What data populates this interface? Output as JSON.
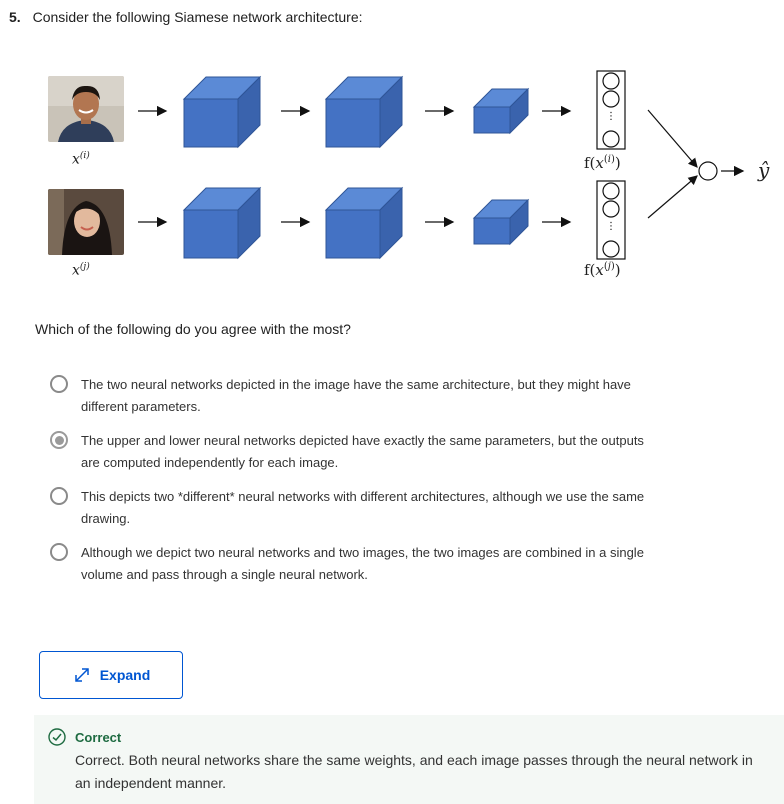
{
  "question": {
    "number": "5.",
    "text": "Consider the following Siamese network architecture:",
    "prompt": "Which of the following do you agree with the most?"
  },
  "diagram": {
    "input_top_label": "x(i)",
    "input_bottom_label": "x(j)",
    "output_top_label": "f(x(i))",
    "output_bottom_label": "f(x(j))",
    "final_output_label": "ŷ",
    "cube_color": "#4472c4",
    "photo_top_desc_icon": "male-face-photo",
    "photo_bottom_desc_icon": "female-face-photo"
  },
  "options": [
    {
      "text": "The two neural networks depicted in the image have the same architecture, but they might have different parameters.",
      "selected": false
    },
    {
      "text": "The upper and lower neural networks depicted have exactly the same parameters, but the outputs are computed independently for each image.",
      "selected": true
    },
    {
      "text": "This depicts two *different* neural networks with different architectures, although we use the same drawing.",
      "selected": false
    },
    {
      "text": "Although we depict two neural networks and two images, the two images are combined in a single volume and pass through a single neural network.",
      "selected": false
    }
  ],
  "expand_button": {
    "label": "Expand",
    "icon": "expand-arrows-icon"
  },
  "feedback": {
    "status": "Correct",
    "message": "Correct. Both neural networks share the same weights, and each image passes through the neural network in an independent manner.",
    "color": "#1e6b41"
  }
}
